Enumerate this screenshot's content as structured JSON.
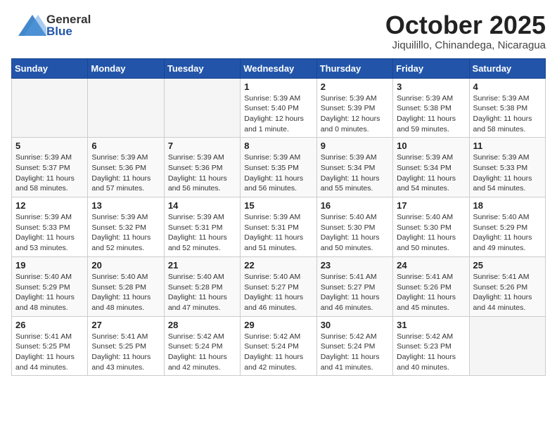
{
  "header": {
    "logo_line1": "General",
    "logo_line2": "Blue",
    "month_title": "October 2025",
    "location": "Jiquilillo, Chinandega, Nicaragua"
  },
  "weekdays": [
    "Sunday",
    "Monday",
    "Tuesday",
    "Wednesday",
    "Thursday",
    "Friday",
    "Saturday"
  ],
  "weeks": [
    [
      {
        "day": "",
        "content": ""
      },
      {
        "day": "",
        "content": ""
      },
      {
        "day": "",
        "content": ""
      },
      {
        "day": "1",
        "content": "Sunrise: 5:39 AM\nSunset: 5:40 PM\nDaylight: 12 hours\nand 1 minute."
      },
      {
        "day": "2",
        "content": "Sunrise: 5:39 AM\nSunset: 5:39 PM\nDaylight: 12 hours\nand 0 minutes."
      },
      {
        "day": "3",
        "content": "Sunrise: 5:39 AM\nSunset: 5:38 PM\nDaylight: 11 hours\nand 59 minutes."
      },
      {
        "day": "4",
        "content": "Sunrise: 5:39 AM\nSunset: 5:38 PM\nDaylight: 11 hours\nand 58 minutes."
      }
    ],
    [
      {
        "day": "5",
        "content": "Sunrise: 5:39 AM\nSunset: 5:37 PM\nDaylight: 11 hours\nand 58 minutes."
      },
      {
        "day": "6",
        "content": "Sunrise: 5:39 AM\nSunset: 5:36 PM\nDaylight: 11 hours\nand 57 minutes."
      },
      {
        "day": "7",
        "content": "Sunrise: 5:39 AM\nSunset: 5:36 PM\nDaylight: 11 hours\nand 56 minutes."
      },
      {
        "day": "8",
        "content": "Sunrise: 5:39 AM\nSunset: 5:35 PM\nDaylight: 11 hours\nand 56 minutes."
      },
      {
        "day": "9",
        "content": "Sunrise: 5:39 AM\nSunset: 5:34 PM\nDaylight: 11 hours\nand 55 minutes."
      },
      {
        "day": "10",
        "content": "Sunrise: 5:39 AM\nSunset: 5:34 PM\nDaylight: 11 hours\nand 54 minutes."
      },
      {
        "day": "11",
        "content": "Sunrise: 5:39 AM\nSunset: 5:33 PM\nDaylight: 11 hours\nand 54 minutes."
      }
    ],
    [
      {
        "day": "12",
        "content": "Sunrise: 5:39 AM\nSunset: 5:33 PM\nDaylight: 11 hours\nand 53 minutes."
      },
      {
        "day": "13",
        "content": "Sunrise: 5:39 AM\nSunset: 5:32 PM\nDaylight: 11 hours\nand 52 minutes."
      },
      {
        "day": "14",
        "content": "Sunrise: 5:39 AM\nSunset: 5:31 PM\nDaylight: 11 hours\nand 52 minutes."
      },
      {
        "day": "15",
        "content": "Sunrise: 5:39 AM\nSunset: 5:31 PM\nDaylight: 11 hours\nand 51 minutes."
      },
      {
        "day": "16",
        "content": "Sunrise: 5:40 AM\nSunset: 5:30 PM\nDaylight: 11 hours\nand 50 minutes."
      },
      {
        "day": "17",
        "content": "Sunrise: 5:40 AM\nSunset: 5:30 PM\nDaylight: 11 hours\nand 50 minutes."
      },
      {
        "day": "18",
        "content": "Sunrise: 5:40 AM\nSunset: 5:29 PM\nDaylight: 11 hours\nand 49 minutes."
      }
    ],
    [
      {
        "day": "19",
        "content": "Sunrise: 5:40 AM\nSunset: 5:29 PM\nDaylight: 11 hours\nand 48 minutes."
      },
      {
        "day": "20",
        "content": "Sunrise: 5:40 AM\nSunset: 5:28 PM\nDaylight: 11 hours\nand 48 minutes."
      },
      {
        "day": "21",
        "content": "Sunrise: 5:40 AM\nSunset: 5:28 PM\nDaylight: 11 hours\nand 47 minutes."
      },
      {
        "day": "22",
        "content": "Sunrise: 5:40 AM\nSunset: 5:27 PM\nDaylight: 11 hours\nand 46 minutes."
      },
      {
        "day": "23",
        "content": "Sunrise: 5:41 AM\nSunset: 5:27 PM\nDaylight: 11 hours\nand 46 minutes."
      },
      {
        "day": "24",
        "content": "Sunrise: 5:41 AM\nSunset: 5:26 PM\nDaylight: 11 hours\nand 45 minutes."
      },
      {
        "day": "25",
        "content": "Sunrise: 5:41 AM\nSunset: 5:26 PM\nDaylight: 11 hours\nand 44 minutes."
      }
    ],
    [
      {
        "day": "26",
        "content": "Sunrise: 5:41 AM\nSunset: 5:25 PM\nDaylight: 11 hours\nand 44 minutes."
      },
      {
        "day": "27",
        "content": "Sunrise: 5:41 AM\nSunset: 5:25 PM\nDaylight: 11 hours\nand 43 minutes."
      },
      {
        "day": "28",
        "content": "Sunrise: 5:42 AM\nSunset: 5:24 PM\nDaylight: 11 hours\nand 42 minutes."
      },
      {
        "day": "29",
        "content": "Sunrise: 5:42 AM\nSunset: 5:24 PM\nDaylight: 11 hours\nand 42 minutes."
      },
      {
        "day": "30",
        "content": "Sunrise: 5:42 AM\nSunset: 5:24 PM\nDaylight: 11 hours\nand 41 minutes."
      },
      {
        "day": "31",
        "content": "Sunrise: 5:42 AM\nSunset: 5:23 PM\nDaylight: 11 hours\nand 40 minutes."
      },
      {
        "day": "",
        "content": ""
      }
    ]
  ]
}
